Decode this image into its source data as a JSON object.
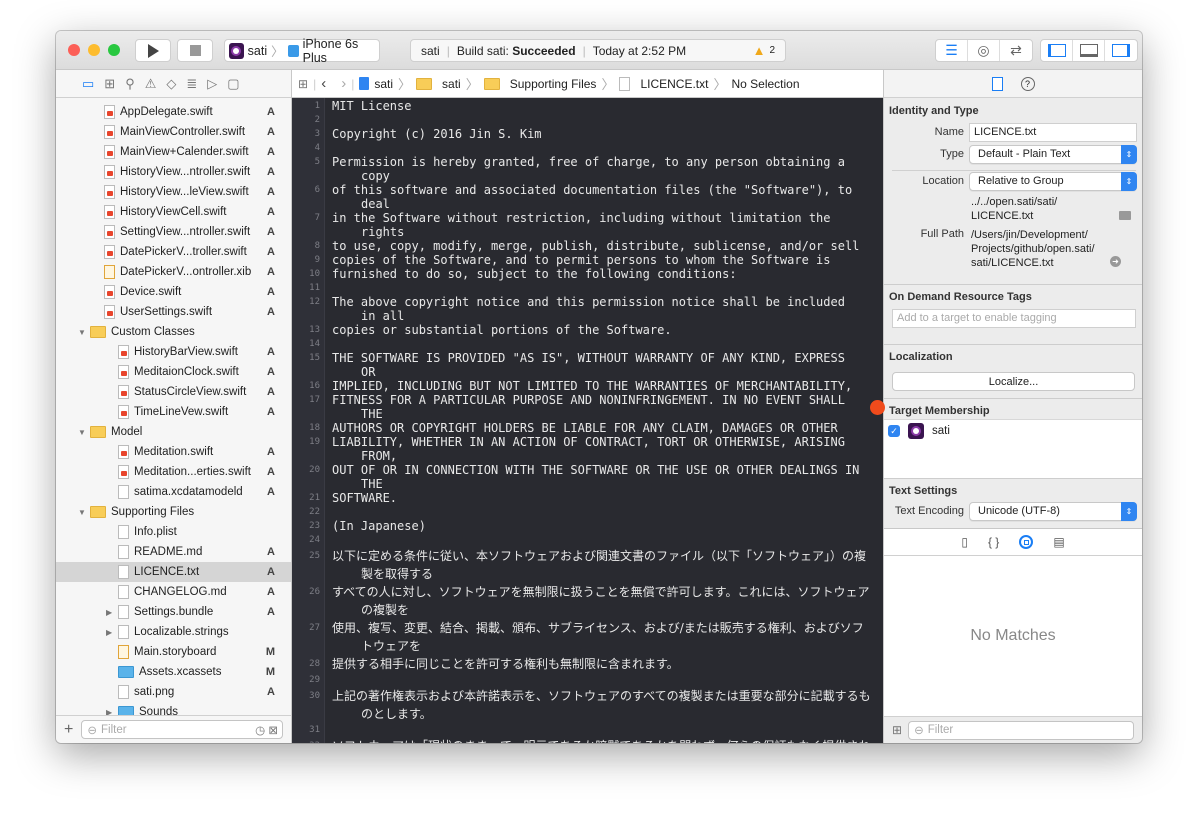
{
  "toolbar": {
    "scheme_target": "sati",
    "scheme_device": "iPhone 6s Plus",
    "status_project": "sati",
    "status_build": "Build sati:",
    "status_result": "Succeeded",
    "status_time": "Today at 2:52 PM",
    "warning_count": "2"
  },
  "navigator": {
    "items": [
      {
        "name": "AppDelegate.swift",
        "status": "A",
        "kind": "swift",
        "level": 2
      },
      {
        "name": "MainViewController.swift",
        "status": "A",
        "kind": "swift",
        "level": 2
      },
      {
        "name": "MainView+Calender.swift",
        "status": "A",
        "kind": "swift",
        "level": 2
      },
      {
        "name": "HistoryView...ntroller.swift",
        "status": "A",
        "kind": "swift",
        "level": 2
      },
      {
        "name": "HistoryView...leView.swift",
        "status": "A",
        "kind": "swift",
        "level": 2
      },
      {
        "name": "HistoryViewCell.swift",
        "status": "A",
        "kind": "swift",
        "level": 2
      },
      {
        "name": "SettingView...ntroller.swift",
        "status": "A",
        "kind": "swift",
        "level": 2
      },
      {
        "name": "DatePickerV...troller.swift",
        "status": "A",
        "kind": "swift",
        "level": 2
      },
      {
        "name": "DatePickerV...ontroller.xib",
        "status": "A",
        "kind": "xib",
        "level": 2
      },
      {
        "name": "Device.swift",
        "status": "A",
        "kind": "swift",
        "level": 2
      },
      {
        "name": "UserSettings.swift",
        "status": "A",
        "kind": "swift",
        "level": 2
      },
      {
        "name": "Custom Classes",
        "status": "",
        "kind": "folder",
        "level": 1,
        "open": true
      },
      {
        "name": "HistoryBarView.swift",
        "status": "A",
        "kind": "swift",
        "level": 3
      },
      {
        "name": "MeditaionClock.swift",
        "status": "A",
        "kind": "swift",
        "level": 3
      },
      {
        "name": "StatusCircleView.swift",
        "status": "A",
        "kind": "swift",
        "level": 3
      },
      {
        "name": "TimeLineVew.swift",
        "status": "A",
        "kind": "swift",
        "level": 3
      },
      {
        "name": "Model",
        "status": "",
        "kind": "folder",
        "level": 1,
        "open": true
      },
      {
        "name": "Meditation.swift",
        "status": "A",
        "kind": "swift",
        "level": 3
      },
      {
        "name": "Meditation...erties.swift",
        "status": "A",
        "kind": "swift",
        "level": 3
      },
      {
        "name": "satima.xcdatamodeld",
        "status": "A",
        "kind": "file",
        "level": 3
      },
      {
        "name": "Supporting Files",
        "status": "",
        "kind": "folder",
        "level": 1,
        "open": true
      },
      {
        "name": "Info.plist",
        "status": "",
        "kind": "file",
        "level": 3
      },
      {
        "name": "README.md",
        "status": "A",
        "kind": "file",
        "level": 3
      },
      {
        "name": "LICENCE.txt",
        "status": "A",
        "kind": "file",
        "level": 3,
        "selected": true
      },
      {
        "name": "CHANGELOG.md",
        "status": "A",
        "kind": "file",
        "level": 3
      },
      {
        "name": "Settings.bundle",
        "status": "A",
        "kind": "file",
        "level": 3,
        "closed": true
      },
      {
        "name": "Localizable.strings",
        "status": "",
        "kind": "file",
        "level": 3,
        "closed": true
      },
      {
        "name": "Main.storyboard",
        "status": "M",
        "kind": "xib",
        "level": 3
      },
      {
        "name": "Assets.xcassets",
        "status": "M",
        "kind": "bluefolder",
        "level": 3
      },
      {
        "name": "sati.png",
        "status": "A",
        "kind": "file",
        "level": 3
      },
      {
        "name": "Sounds",
        "status": "",
        "kind": "bluefolder",
        "level": 3,
        "closed": true
      }
    ],
    "filter_placeholder": "Filter"
  },
  "jumpbar": {
    "crumbs": [
      "sati",
      "sati",
      "Supporting Files",
      "LICENCE.txt",
      "No Selection"
    ]
  },
  "editor": {
    "lines": [
      {
        "n": "1",
        "rows": [
          "MIT License"
        ]
      },
      {
        "n": "2",
        "rows": [
          ""
        ]
      },
      {
        "n": "3",
        "rows": [
          "Copyright (c) 2016 Jin S. Kim"
        ]
      },
      {
        "n": "4",
        "rows": [
          ""
        ]
      },
      {
        "n": "5",
        "rows": [
          "Permission is hereby granted, free of charge, to any person obtaining a",
          "copy"
        ]
      },
      {
        "n": "6",
        "rows": [
          "of this software and associated documentation files (the \"Software\"), to",
          "deal"
        ]
      },
      {
        "n": "7",
        "rows": [
          "in the Software without restriction, including without limitation the",
          "rights"
        ]
      },
      {
        "n": "8",
        "rows": [
          "to use, copy, modify, merge, publish, distribute, sublicense, and/or sell"
        ]
      },
      {
        "n": "9",
        "rows": [
          "copies of the Software, and to permit persons to whom the Software is"
        ]
      },
      {
        "n": "10",
        "rows": [
          "furnished to do so, subject to the following conditions:"
        ]
      },
      {
        "n": "11",
        "rows": [
          ""
        ]
      },
      {
        "n": "12",
        "rows": [
          "The above copyright notice and this permission notice shall be included",
          "in all"
        ]
      },
      {
        "n": "13",
        "rows": [
          "copies or substantial portions of the Software."
        ]
      },
      {
        "n": "14",
        "rows": [
          ""
        ]
      },
      {
        "n": "15",
        "rows": [
          "THE SOFTWARE IS PROVIDED \"AS IS\", WITHOUT WARRANTY OF ANY KIND, EXPRESS",
          "OR"
        ]
      },
      {
        "n": "16",
        "rows": [
          "IMPLIED, INCLUDING BUT NOT LIMITED TO THE WARRANTIES OF MERCHANTABILITY,"
        ]
      },
      {
        "n": "17",
        "rows": [
          "FITNESS FOR A PARTICULAR PURPOSE AND NONINFRINGEMENT. IN NO EVENT SHALL",
          "THE"
        ]
      },
      {
        "n": "18",
        "rows": [
          "AUTHORS OR COPYRIGHT HOLDERS BE LIABLE FOR ANY CLAIM, DAMAGES OR OTHER"
        ]
      },
      {
        "n": "19",
        "rows": [
          "LIABILITY, WHETHER IN AN ACTION OF CONTRACT, TORT OR OTHERWISE, ARISING",
          "FROM,"
        ]
      },
      {
        "n": "20",
        "rows": [
          "OUT OF OR IN CONNECTION WITH THE SOFTWARE OR THE USE OR OTHER DEALINGS IN",
          "THE"
        ]
      },
      {
        "n": "21",
        "rows": [
          "SOFTWARE."
        ]
      },
      {
        "n": "22",
        "rows": [
          ""
        ]
      },
      {
        "n": "23",
        "rows": [
          "(In Japanese)"
        ]
      },
      {
        "n": "24",
        "rows": [
          ""
        ]
      },
      {
        "n": "25",
        "ja": true,
        "rows": [
          "以下に定める条件に従い、本ソフトウェアおよび関連文書のファイル（以下「ソフトウェア」）の複",
          "製を取得する"
        ]
      },
      {
        "n": "26",
        "ja": true,
        "rows": [
          "すべての人に対し、ソフトウェアを無制限に扱うことを無償で許可します。これには、ソフトウェア",
          "の複製を"
        ]
      },
      {
        "n": "27",
        "ja": true,
        "rows": [
          "使用、複写、変更、結合、掲載、頒布、サブライセンス、および/または販売する権利、およびソフ",
          "トウェアを"
        ]
      },
      {
        "n": "28",
        "ja": true,
        "rows": [
          "提供する相手に同じことを許可する権利も無制限に含まれます。"
        ]
      },
      {
        "n": "29",
        "rows": [
          ""
        ]
      },
      {
        "n": "30",
        "ja": true,
        "rows": [
          "上記の著作権表示および本許諾表示を、ソフトウェアのすべての複製または重要な部分に記載するも",
          "のとします。"
        ]
      },
      {
        "n": "31",
        "rows": [
          ""
        ]
      },
      {
        "n": "32",
        "ja": true,
        "rows": [
          "ソフトウェアは「現状のまま」で、明示であるか暗黙であるかを問わず、何らの保証もなく提供され"
        ]
      }
    ]
  },
  "inspector": {
    "identity": {
      "title": "Identity and Type",
      "name_label": "Name",
      "name_value": "LICENCE.txt",
      "type_label": "Type",
      "type_value": "Default - Plain Text",
      "location_label": "Location",
      "location_value": "Relative to Group",
      "rel_path_1": "../../open.sati/sati/",
      "rel_path_2": "LICENCE.txt",
      "fullpath_label": "Full Path",
      "fullpath_1": "/Users/jin/Development/",
      "fullpath_2": "Projects/github/open.sati/",
      "fullpath_3": "sati/LICENCE.txt"
    },
    "tags": {
      "title": "On Demand Resource Tags",
      "placeholder": "Add to a target to enable tagging"
    },
    "localization": {
      "title": "Localization",
      "button": "Localize..."
    },
    "membership": {
      "title": "Target Membership",
      "target": "sati",
      "checked": true
    },
    "text_settings": {
      "title": "Text Settings",
      "encoding_label": "Text Encoding",
      "encoding_value": "Unicode (UTF-8)"
    },
    "library": {
      "empty": "No Matches",
      "filter_placeholder": "Filter"
    }
  },
  "colors": {
    "accent": "#1a7ef5",
    "editor_bg": "#292a30",
    "breakpoint": "#f04b1c"
  }
}
